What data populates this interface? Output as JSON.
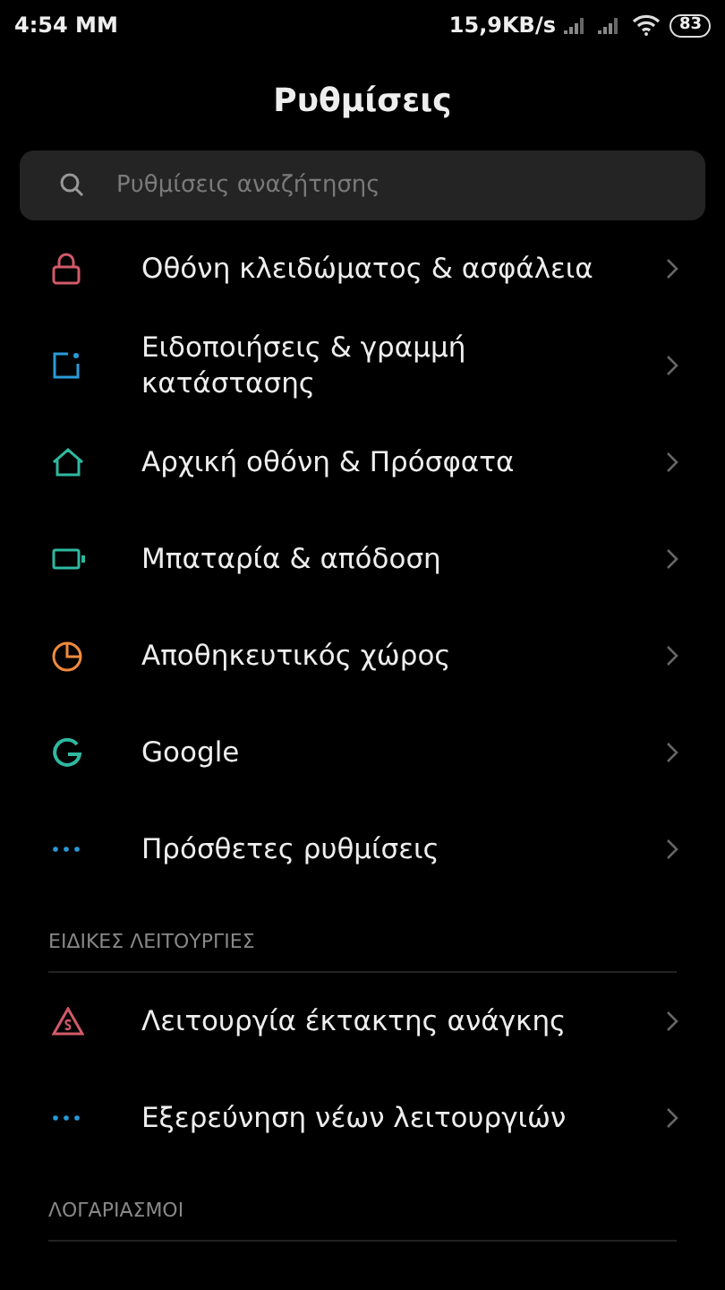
{
  "status_bar": {
    "time": "4:54 ΜΜ",
    "speed": "15,9KB/s",
    "battery": "83"
  },
  "title": "Ρυθμίσεις",
  "search": {
    "placeholder": "Ρυθμίσεις αναζήτησης"
  },
  "sections": [
    {
      "items": [
        {
          "kind": "lock",
          "color": "#d25a6a",
          "label": "Οθόνη κλειδώματος & ασφάλεια"
        },
        {
          "kind": "notification",
          "color": "#2a9ad8",
          "label": "Ειδοποιήσεις & γραμμή κατάστασης"
        },
        {
          "kind": "home",
          "color": "#2fb8a0",
          "label": "Αρχική οθόνη & Πρόσφατα"
        },
        {
          "kind": "battery",
          "color": "#2fb8a0",
          "label": "Μπαταρία & απόδοση"
        },
        {
          "kind": "storage",
          "color": "#f08a3c",
          "label": "Αποθηκευτικός χώρος"
        },
        {
          "kind": "google",
          "color": "#2fb8a0",
          "label": "Google"
        },
        {
          "kind": "more",
          "color": "#2a9ad8",
          "label": "Πρόσθετες ρυθμίσεις"
        }
      ]
    },
    {
      "header": "ΕΙΔΙΚΕΣ ΛΕΙΤΟΥΡΓΙΕΣ",
      "items": [
        {
          "kind": "sos",
          "color": "#d25a6a",
          "label": "Λειτουργία έκτακτης ανάγκης"
        },
        {
          "kind": "more",
          "color": "#2a9ad8",
          "label": "Εξερεύνηση νέων λειτουργιών"
        }
      ]
    },
    {
      "header": "ΛΟΓΑΡΙΑΣΜΟΙ"
    }
  ]
}
